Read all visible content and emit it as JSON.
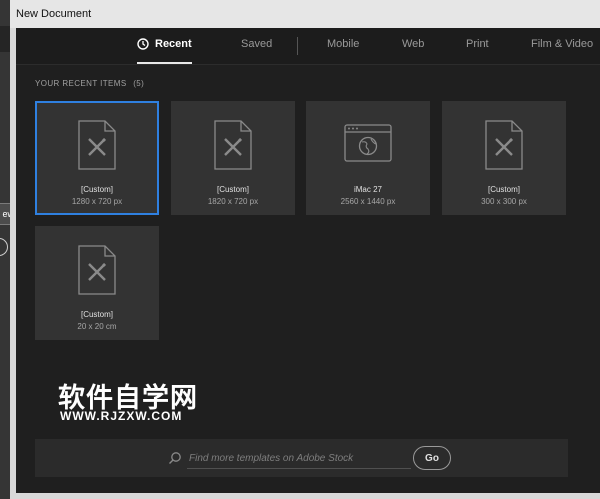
{
  "window": {
    "title": "New Document"
  },
  "background": {
    "view_button_label": "ew"
  },
  "tabs": [
    {
      "label": "Recent",
      "active": true,
      "icon": "clock-icon"
    },
    {
      "label": "Saved",
      "active": false
    },
    {
      "label": "Mobile",
      "active": false
    },
    {
      "label": "Web",
      "active": false
    },
    {
      "label": "Print",
      "active": false
    },
    {
      "label": "Film & Video",
      "active": false
    }
  ],
  "recent": {
    "heading": "YOUR RECENT ITEMS",
    "count": "(5)",
    "items": [
      {
        "name": "[Custom]",
        "size": "1280 x 720 px",
        "icon": "custom-document-icon",
        "selected": true
      },
      {
        "name": "[Custom]",
        "size": "1820 x 720 px",
        "icon": "custom-document-icon",
        "selected": false
      },
      {
        "name": "iMac 27",
        "size": "2560 x 1440 px",
        "icon": "web-browser-icon",
        "selected": false
      },
      {
        "name": "[Custom]",
        "size": "300 x 300 px",
        "icon": "custom-document-icon",
        "selected": false
      },
      {
        "name": "[Custom]",
        "size": "20 x 20 cm",
        "icon": "custom-document-icon",
        "selected": false
      }
    ]
  },
  "stock": {
    "placeholder": "Find more templates on Adobe Stock",
    "go_label": "Go"
  },
  "watermark": {
    "title": "软件自学网",
    "url": "WWW.RJZXW.COM"
  },
  "colors": {
    "accent": "#2f80e0",
    "panel": "#1f1f1f",
    "tile": "#333333"
  }
}
